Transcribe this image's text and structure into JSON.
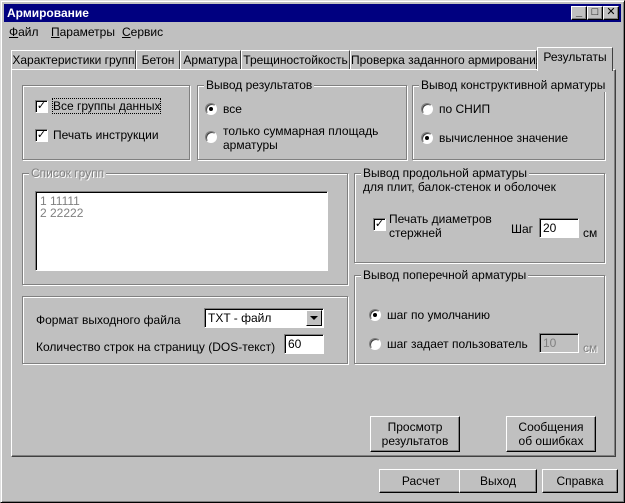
{
  "window": {
    "title": "Армирование",
    "min_glyph": "_",
    "max_glyph": "□",
    "close_glyph": "✕"
  },
  "menu": [
    {
      "label": "Файл",
      "key": "Ф",
      "rest": "айл"
    },
    {
      "label": "Параметры",
      "key": "П",
      "rest": "араметры"
    },
    {
      "label": "Сервис",
      "key": "С",
      "rest": "ервис"
    }
  ],
  "tabs": [
    {
      "label": "Характеристики групп"
    },
    {
      "label": "Бетон"
    },
    {
      "label": "Арматура"
    },
    {
      "label": "Трещиностойкость"
    },
    {
      "label": "Проверка заданного армирования"
    },
    {
      "label": "Результаты",
      "active": true
    }
  ],
  "options": {
    "all_groups": {
      "label": "Все группы данных",
      "checked": true
    },
    "print_instructions": {
      "label": "Печать инструкции",
      "checked": true
    }
  },
  "output_results": {
    "title": "Вывод результатов",
    "all": {
      "label": "все",
      "selected": true
    },
    "summary": {
      "label_line1": "только суммарная площадь",
      "label_line2": "арматуры",
      "selected": false
    }
  },
  "constructive": {
    "title": "Вывод конструктивной арматуры",
    "snip": {
      "label": "по СНИП",
      "selected": false
    },
    "computed": {
      "label": "вычисленное значение",
      "selected": true
    }
  },
  "group_list": {
    "title": "Список групп",
    "items": [
      "1 11111",
      "2 22222"
    ]
  },
  "longitudinal": {
    "title_line1": "Вывод продольной арматуры",
    "title_line2": "для плит, балок-стенок и оболочек",
    "print_diam_line1": "Печать диаметров",
    "print_diam_line2": "стержней",
    "print_diam_checked": true,
    "step_label": "Шаг",
    "step_value": "20",
    "unit": "см"
  },
  "transverse": {
    "title": "Вывод поперечной арматуры",
    "default_step": {
      "label": "шаг по умолчанию",
      "selected": true
    },
    "user_step": {
      "label": "шаг задает пользователь",
      "selected": false
    },
    "step_value": "10",
    "unit": "см"
  },
  "output_file": {
    "format_label": "Формат выходного файла",
    "format_value": "TXT - файл",
    "lines_label": "Количество строк на страницу (DOS-текст)",
    "lines_value": "60"
  },
  "buttons": {
    "view_line1": "Просмотр",
    "view_line2": "результатов",
    "errors_line1": "Сообщения",
    "errors_line2": "об ошибках",
    "calc": "Расчет",
    "exit": "Выход",
    "help": "Справка"
  }
}
